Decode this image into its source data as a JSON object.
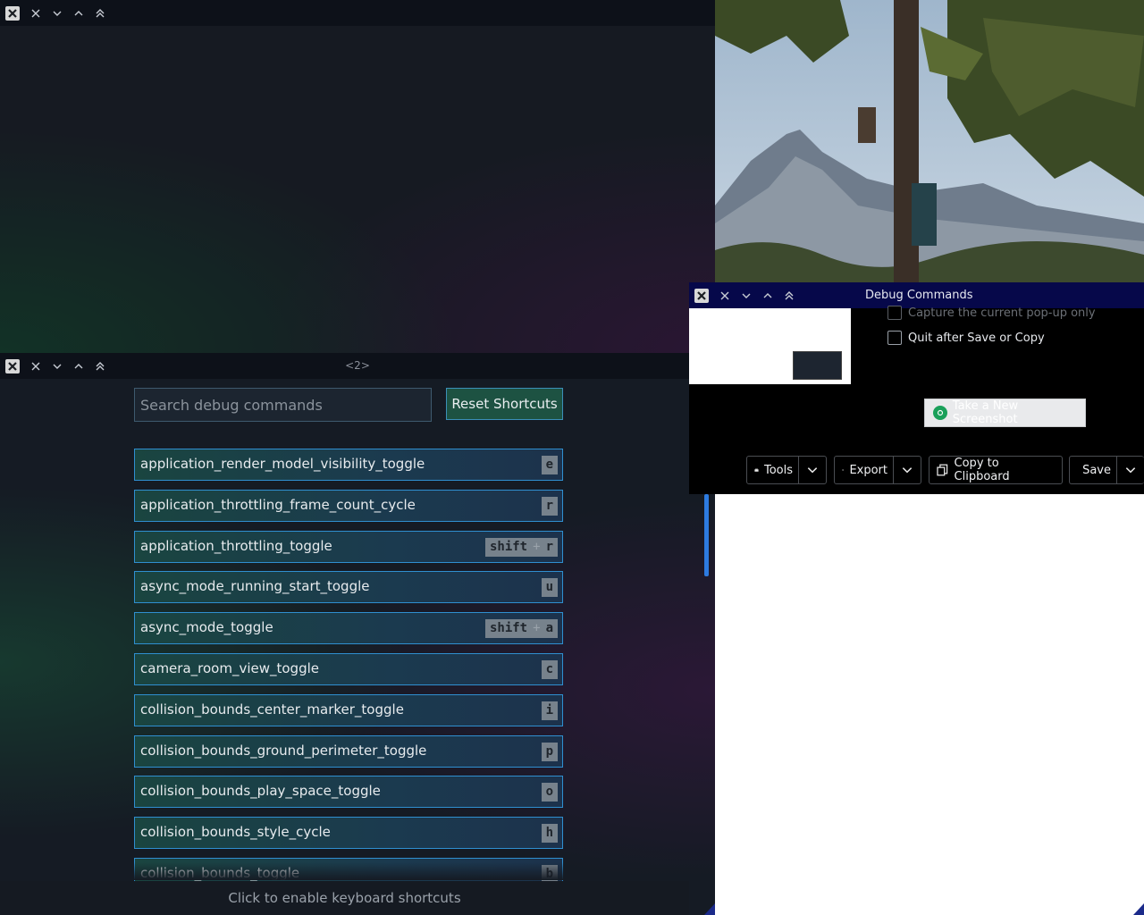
{
  "top_window": {},
  "debug_window": {
    "title": "<2>",
    "search_placeholder": "Search debug commands",
    "reset_label": "Reset Shortcuts",
    "footer": "Click to enable keyboard shortcuts",
    "commands": [
      {
        "name": "application_render_model_visibility_toggle",
        "keys": [
          "e"
        ]
      },
      {
        "name": "application_throttling_frame_count_cycle",
        "keys": [
          "r"
        ]
      },
      {
        "name": "application_throttling_toggle",
        "keys": [
          "shift",
          "r"
        ]
      },
      {
        "name": "async_mode_running_start_toggle",
        "keys": [
          "u"
        ]
      },
      {
        "name": "async_mode_toggle",
        "keys": [
          "shift",
          "a"
        ]
      },
      {
        "name": "camera_room_view_toggle",
        "keys": [
          "c"
        ]
      },
      {
        "name": "collision_bounds_center_marker_toggle",
        "keys": [
          "i"
        ]
      },
      {
        "name": "collision_bounds_ground_perimeter_toggle",
        "keys": [
          "p"
        ]
      },
      {
        "name": "collision_bounds_play_space_toggle",
        "keys": [
          "o"
        ]
      },
      {
        "name": "collision_bounds_style_cycle",
        "keys": [
          "h"
        ]
      },
      {
        "name": "collision_bounds_toggle",
        "keys": [
          "b"
        ]
      }
    ]
  },
  "screenshot_dialog": {
    "title": "Debug Commands",
    "option_popup": "Capture the current pop-up only",
    "option_quit": "Quit after Save or Copy",
    "new_screenshot": "Take a New Screenshot",
    "toolbar": {
      "tools": "Tools",
      "export": "Export",
      "copy": "Copy to Clipboard",
      "save": "Save"
    }
  },
  "colors": {
    "accent": "#2f8fd0",
    "dialog_titlebar": "#06084a",
    "reset_button": "#1d5242"
  }
}
